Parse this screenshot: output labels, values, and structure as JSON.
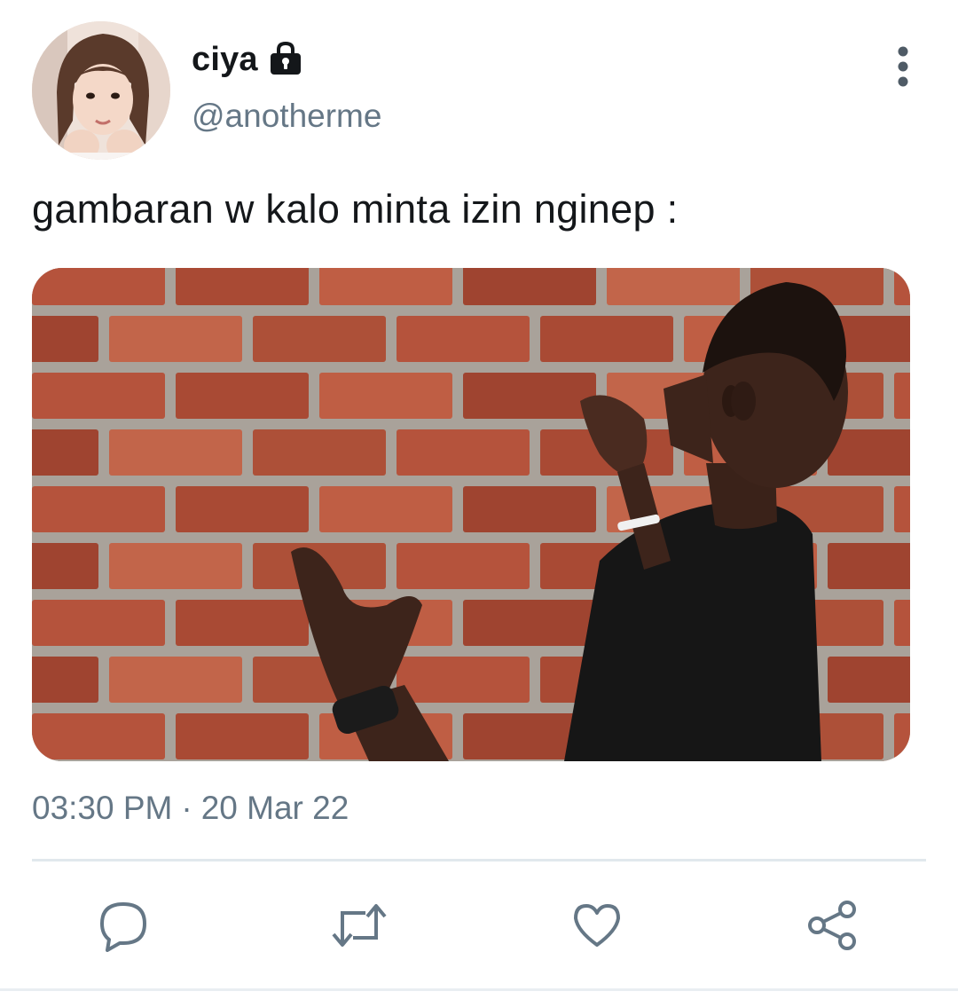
{
  "user": {
    "display_name": "ciya",
    "handle": "@anotherme",
    "protected_icon": "lock-icon"
  },
  "tweet": {
    "text": "gambaran w kalo minta izin nginep :",
    "time": "03:30 PM",
    "separator": "·",
    "date": "20 Mar 22"
  },
  "actions": [
    {
      "name": "reply",
      "icon": "comment-icon"
    },
    {
      "name": "retweet",
      "icon": "retweet-icon"
    },
    {
      "name": "like",
      "icon": "heart-icon"
    },
    {
      "name": "share",
      "icon": "share-icon"
    }
  ],
  "colors": {
    "text_primary": "#14171a",
    "text_secondary": "#657786",
    "icon_gray": "#657786",
    "divider": "#e1e8ed",
    "brick": "#b5563f"
  }
}
